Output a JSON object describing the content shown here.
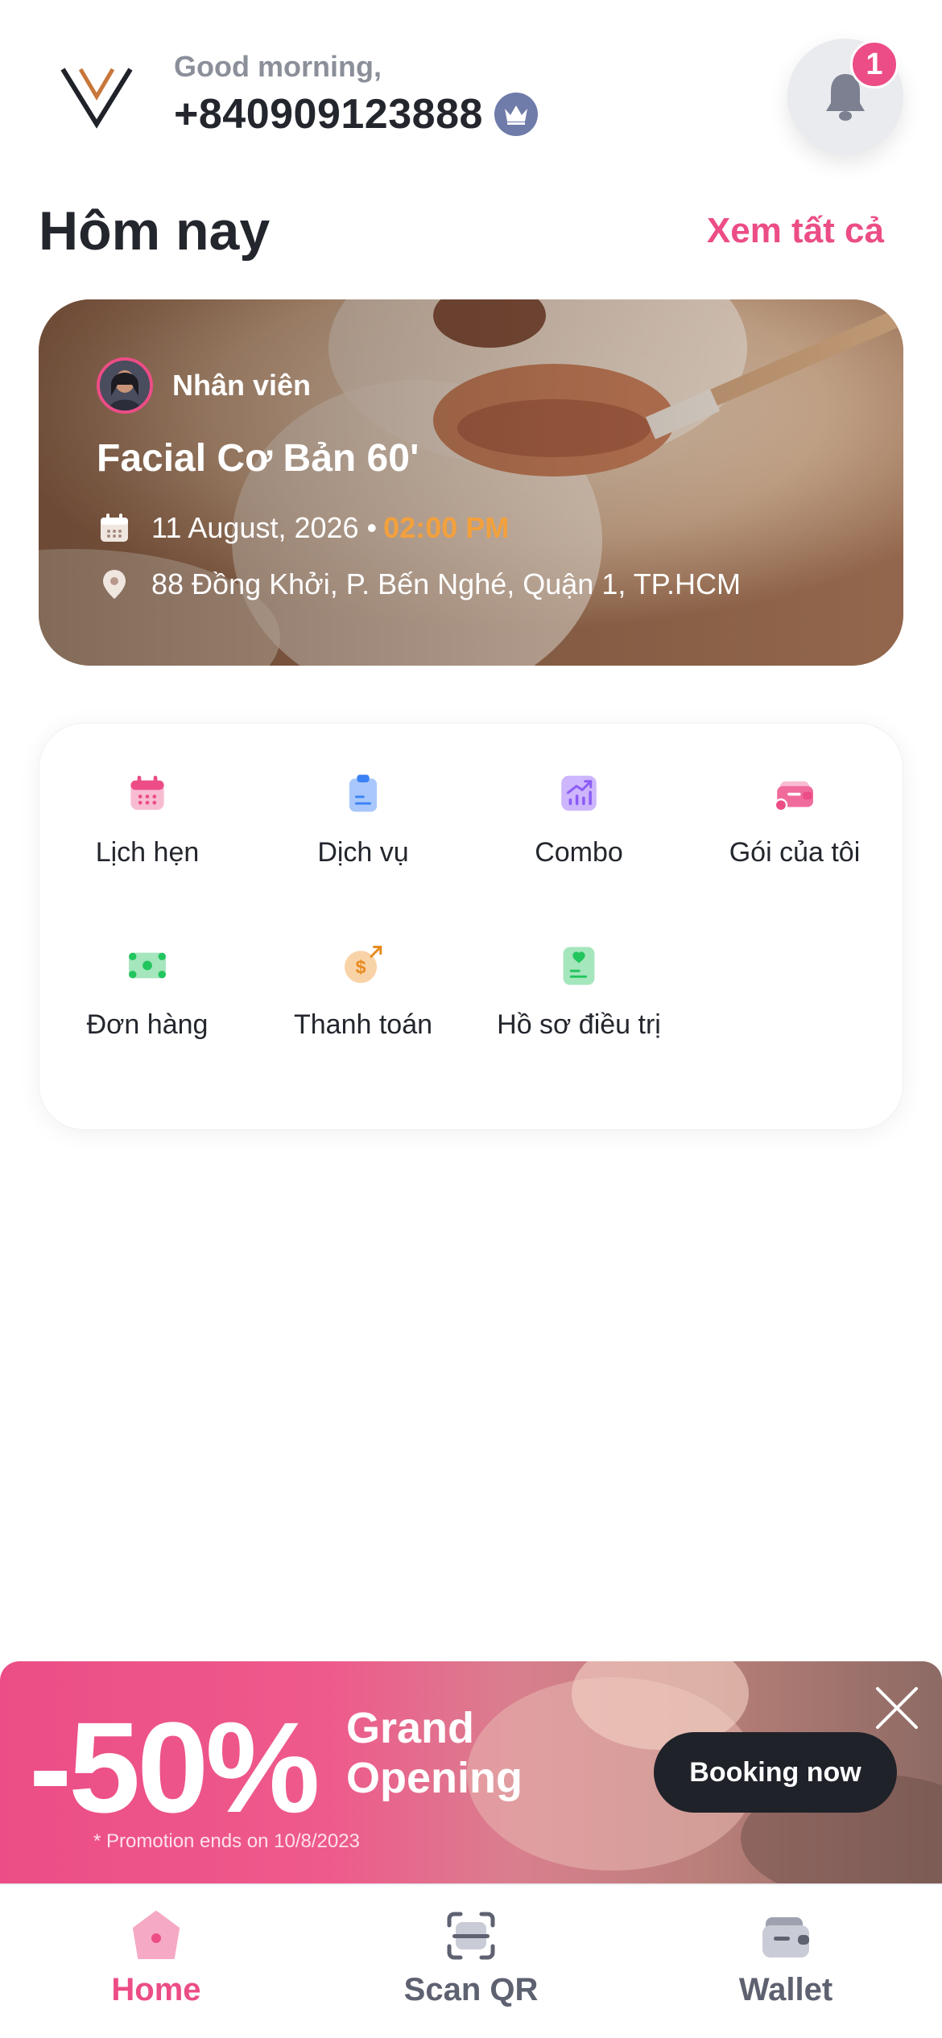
{
  "header": {
    "greeting": "Good morning,",
    "phone": "+840909123888",
    "notification_count": "1"
  },
  "today": {
    "title": "Hôm nay",
    "see_all": "Xem tất cả"
  },
  "appointment": {
    "staff_label": "Nhân viên",
    "service": "Facial Cơ Bản 60'",
    "date": "11 August, 2026 •",
    "time": "02:00 PM",
    "address": "88 Đồng Khởi, P. Bến Nghé, Quận 1, TP.HCM"
  },
  "menu": {
    "items": [
      {
        "label": "Lịch hẹn",
        "icon": "calendar-icon"
      },
      {
        "label": "Dịch vụ",
        "icon": "clipboard-icon"
      },
      {
        "label": "Combo",
        "icon": "chart-up-icon"
      },
      {
        "label": "Gói của tôi",
        "icon": "package-card-icon"
      },
      {
        "label": "Đơn hàng",
        "icon": "cash-icon"
      },
      {
        "label": "Thanh toán",
        "icon": "payment-coin-icon"
      },
      {
        "label": "Hồ sơ điều trị",
        "icon": "treatment-record-icon"
      }
    ]
  },
  "promo": {
    "discount": "-50%",
    "title_line1": "Grand",
    "title_line2": "Opening",
    "note": "* Promotion ends on 10/8/2023",
    "button": "Booking now"
  },
  "nav": {
    "items": [
      {
        "label": "Home",
        "icon": "home-icon",
        "active": true
      },
      {
        "label": "Scan QR",
        "icon": "scan-qr-icon",
        "active": false
      },
      {
        "label": "Wallet",
        "icon": "wallet-icon",
        "active": false
      }
    ]
  },
  "colors": {
    "accent": "#ec4d86",
    "time_highlight": "#f3a13d",
    "text_dark": "#23262d",
    "text_muted": "#8b8f9a"
  }
}
